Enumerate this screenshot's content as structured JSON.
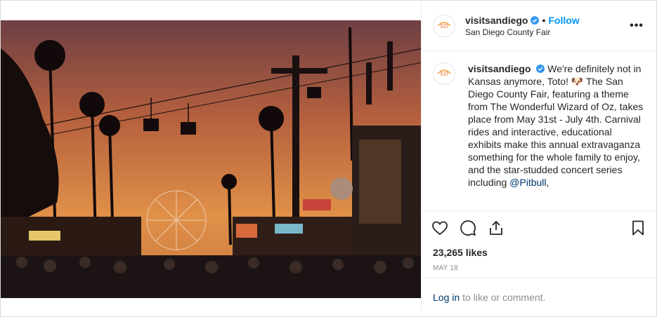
{
  "header": {
    "username": "visitsandiego",
    "separator": "•",
    "follow_label": "Follow",
    "location": "San Diego County Fair",
    "more_label": "•••"
  },
  "caption": {
    "username": "visitsandiego",
    "text": "We're definitely not in Kansas anymore, Toto! 🐶 The San Diego County Fair, featuring a theme from The Wonderful Wizard of Oz, takes place from May 31st - July 4th. Carnival rides and interactive, educational exhibits make this annual extravaganza something for the whole family to enjoy, and the star-studded concert series including ",
    "mention": "@Pitbull",
    "tail": ","
  },
  "stats": {
    "likes": "23,265 likes",
    "date": "MAY 18"
  },
  "footer": {
    "login_label": "Log in",
    "prompt": "to like or comment."
  },
  "icons": [
    "verified-badge-icon",
    "heart-icon",
    "comment-icon",
    "share-icon",
    "bookmark-icon",
    "more-options-icon"
  ],
  "colors": {
    "accent": "#0095f6",
    "link": "#00376b",
    "muted": "#8e8e8e"
  }
}
